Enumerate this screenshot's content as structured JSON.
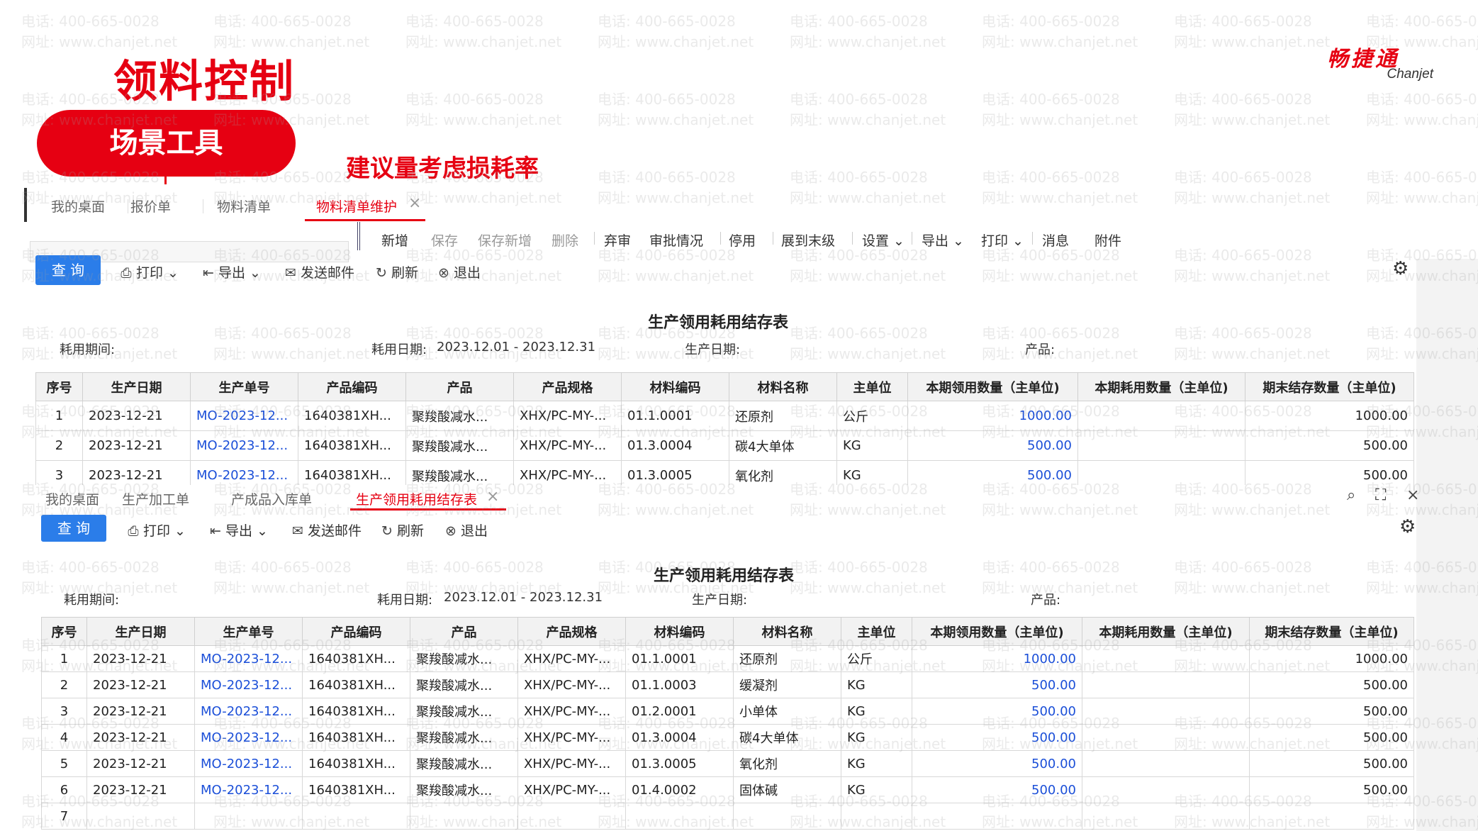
{
  "slide": {
    "title": "领料控制",
    "pill_label": "场景工具",
    "subtitle": "建议量考虑损耗率",
    "logo_cn": "畅捷通",
    "logo_en": "Chanjet",
    "watermark_phone": "电话: 400-665-0028",
    "watermark_site": "网址: www.chanjet.net"
  },
  "win1": {
    "tabs": [
      "我的桌面",
      "报价单",
      "物料清单",
      "物料清单维护"
    ],
    "actions": [
      "新增",
      "保存",
      "保存新增",
      "删除",
      "弃审",
      "审批情况",
      "停用",
      "展到末级",
      "设置",
      "导出",
      "打印",
      "消息",
      "附件"
    ],
    "toolbar": {
      "query": "查 询",
      "print": "打印",
      "export": "导出",
      "email": "发送邮件",
      "refresh": "刷新",
      "exit": "退出"
    },
    "report_title": "生产领用耗用结存表",
    "meta": {
      "period_label": "耗用期间:",
      "date_label": "耗用日期:",
      "date_value": "2023.12.01 - 2023.12.31",
      "prod_date_label": "生产日期:",
      "product_label": "产品:"
    },
    "columns": [
      "序号",
      "生产日期",
      "生产单号",
      "产品编码",
      "产品",
      "产品规格",
      "材料编码",
      "材料名称",
      "主单位",
      "本期领用数量（主单位)",
      "本期耗用数量（主单位)",
      "期末结存数量（主单位)"
    ],
    "rows": [
      [
        "1",
        "2023-12-21",
        "MO-2023-12...",
        "1640381XH...",
        "聚羧酸减水...",
        "XHX/PC-MY-...",
        "01.1.0001",
        "还原剂",
        "公斤",
        "1000.00",
        "",
        "1000.00"
      ],
      [
        "2",
        "2023-12-21",
        "MO-2023-12...",
        "1640381XH...",
        "聚羧酸减水...",
        "XHX/PC-MY-...",
        "01.3.0004",
        "碳4大单体",
        "KG",
        "500.00",
        "",
        "500.00"
      ],
      [
        "3",
        "2023-12-21",
        "MO-2023-12...",
        "1640381XH...",
        "聚羧酸减水...",
        "XHX/PC-MY-...",
        "01.3.0005",
        "氧化剂",
        "KG",
        "500.00",
        "",
        "500.00"
      ]
    ]
  },
  "win2": {
    "tabs": [
      "我的桌面",
      "生产加工单",
      "产成品入库单",
      "生产领用耗用结存表"
    ],
    "toolbar": {
      "query": "查 询",
      "print": "打印",
      "export": "导出",
      "email": "发送邮件",
      "refresh": "刷新",
      "exit": "退出"
    },
    "report_title": "生产领用耗用结存表",
    "meta": {
      "period_label": "耗用期间:",
      "date_label": "耗用日期:",
      "date_value": "2023.12.01 - 2023.12.31",
      "prod_date_label": "生产日期:",
      "product_label": "产品:"
    },
    "columns": [
      "序号",
      "生产日期",
      "生产单号",
      "产品编码",
      "产品",
      "产品规格",
      "材料编码",
      "材料名称",
      "主单位",
      "本期领用数量（主单位)",
      "本期耗用数量（主单位)",
      "期末结存数量（主单位)"
    ],
    "rows": [
      [
        "1",
        "2023-12-21",
        "MO-2023-12...",
        "1640381XH...",
        "聚羧酸减水...",
        "XHX/PC-MY-...",
        "01.1.0001",
        "还原剂",
        "公斤",
        "1000.00",
        "",
        "1000.00"
      ],
      [
        "2",
        "2023-12-21",
        "MO-2023-12...",
        "1640381XH...",
        "聚羧酸减水...",
        "XHX/PC-MY-...",
        "01.1.0003",
        "缓凝剂",
        "KG",
        "500.00",
        "",
        "500.00"
      ],
      [
        "3",
        "2023-12-21",
        "MO-2023-12...",
        "1640381XH...",
        "聚羧酸减水...",
        "XHX/PC-MY-...",
        "01.2.0001",
        "小单体",
        "KG",
        "500.00",
        "",
        "500.00"
      ],
      [
        "4",
        "2023-12-21",
        "MO-2023-12...",
        "1640381XH...",
        "聚羧酸减水...",
        "XHX/PC-MY-...",
        "01.3.0004",
        "碳4大单体",
        "KG",
        "500.00",
        "",
        "500.00"
      ],
      [
        "5",
        "2023-12-21",
        "MO-2023-12...",
        "1640381XH...",
        "聚羧酸减水...",
        "XHX/PC-MY-...",
        "01.3.0005",
        "氧化剂",
        "KG",
        "500.00",
        "",
        "500.00"
      ],
      [
        "6",
        "2023-12-21",
        "MO-2023-12...",
        "1640381XH...",
        "聚羧酸减水...",
        "XHX/PC-MY-...",
        "01.4.0002",
        "固体碱",
        "KG",
        "500.00",
        "",
        "500.00"
      ],
      [
        "7",
        "",
        "",
        "",
        "",
        "",
        "",
        "",
        "",
        "",
        "",
        ""
      ]
    ]
  }
}
